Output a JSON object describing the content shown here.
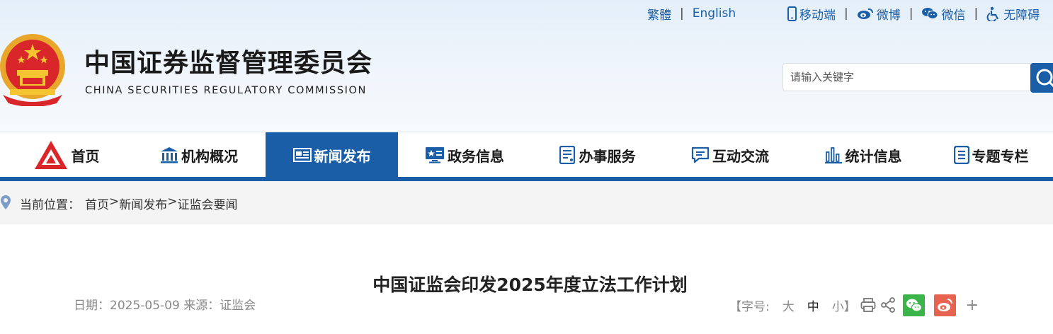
{
  "top_links": {
    "traditional": "繁體",
    "english": "English",
    "mobile": "移动端",
    "weibo": "微博",
    "wechat": "微信",
    "accessibility": "无障碍"
  },
  "header": {
    "title_cn": "中国证券监督管理委员会",
    "title_en": "CHINA SECURITIES REGULATORY COMMISSION"
  },
  "search": {
    "placeholder": "请输入关键字"
  },
  "nav": {
    "items": [
      {
        "label": "首页",
        "icon": "csrc-logo-icon"
      },
      {
        "label": "机构概况",
        "icon": "building-icon"
      },
      {
        "label": "新闻发布",
        "icon": "newspaper-icon"
      },
      {
        "label": "政务信息",
        "icon": "monitor-icon"
      },
      {
        "label": "办事服务",
        "icon": "document-icon"
      },
      {
        "label": "互动交流",
        "icon": "chat-icon"
      },
      {
        "label": "统计信息",
        "icon": "bar-chart-icon"
      },
      {
        "label": "专题专栏",
        "icon": "file-icon"
      }
    ],
    "active_index": 2
  },
  "breadcrumb": {
    "label": "当前位置：",
    "items": [
      "首页",
      "新闻发布",
      "证监会要闻"
    ],
    "separator": ">"
  },
  "article": {
    "title": "中国证监会印发2025年度立法工作计划",
    "date_label": "日期：",
    "date": "2025-05-09",
    "source_label": "来源：",
    "source": "证监会"
  },
  "font_size": {
    "open": "【字号:",
    "large": "大",
    "medium": "中",
    "small": "小",
    "close": "】",
    "current": "中"
  },
  "share_more": "+",
  "colors": {
    "brand_blue": "#1b5ea8",
    "wechat_green": "#3bb54a",
    "weibo_red": "#e8634f"
  }
}
